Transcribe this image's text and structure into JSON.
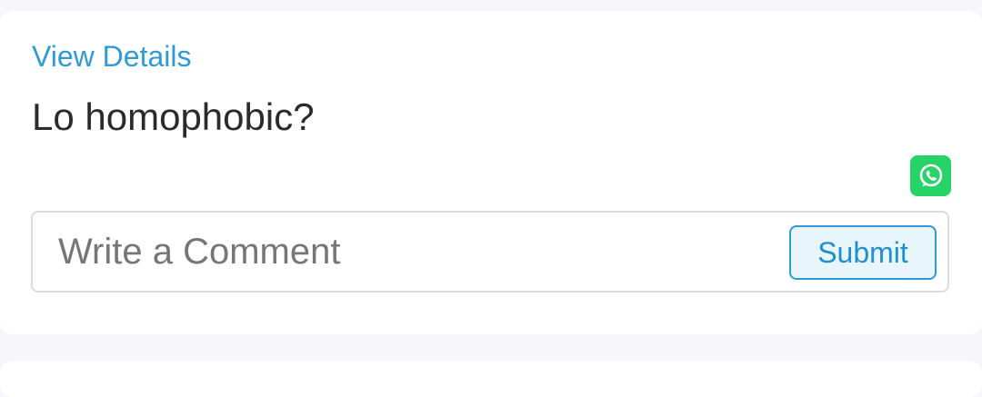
{
  "post": {
    "view_details_label": "View Details",
    "question_text": "Lo homophobic?",
    "share_icon": "whatsapp-icon"
  },
  "comment": {
    "placeholder": "Write a Comment",
    "value": "",
    "submit_label": "Submit"
  },
  "colors": {
    "link": "#2f9bd6",
    "whatsapp": "#25d366",
    "submit_border": "#2f9bd6",
    "submit_bg": "#e8f6fc",
    "page_bg": "#f7f7fb"
  }
}
